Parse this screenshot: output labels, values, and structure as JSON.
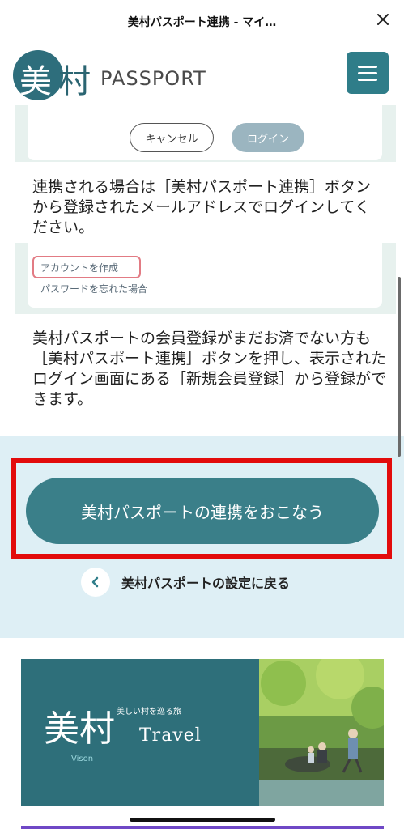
{
  "browser": {
    "title": "美村パスポート連携 - マイ…",
    "close_icon": "close-icon"
  },
  "header": {
    "logo_kanji": "美",
    "logo_kanji2": "村",
    "logo_word": "PASSPORT",
    "menu_icon": "hamburger-icon",
    "brand_color": "#2f7d89"
  },
  "login_card": {
    "cancel_label": "キャンセル",
    "login_label": "ログイン"
  },
  "instructions": {
    "text1": "連携される場合は［美村パスポート連携］ボタンから登録されたメールアドレスでログインしてください。",
    "text2": "美村パスポートの会員登録がまだお済でない方も［美村パスポート連携］ボタンを押し、表示されたログイン画面にある［新規会員登録］から登録ができます。"
  },
  "account_links": {
    "create_label": "アカウントを作成",
    "forgot_label": "パスワードを忘れた場合"
  },
  "actions": {
    "primary_label": "美村パスポートの連携をおこなう",
    "back_label": "美村パスポートの設定に戻る",
    "highlight_color": "#e20b0b"
  },
  "banner": {
    "title": "美村",
    "subtitle": "美しい村を巡る旅",
    "travel": "Travel",
    "vison": "Vison"
  }
}
